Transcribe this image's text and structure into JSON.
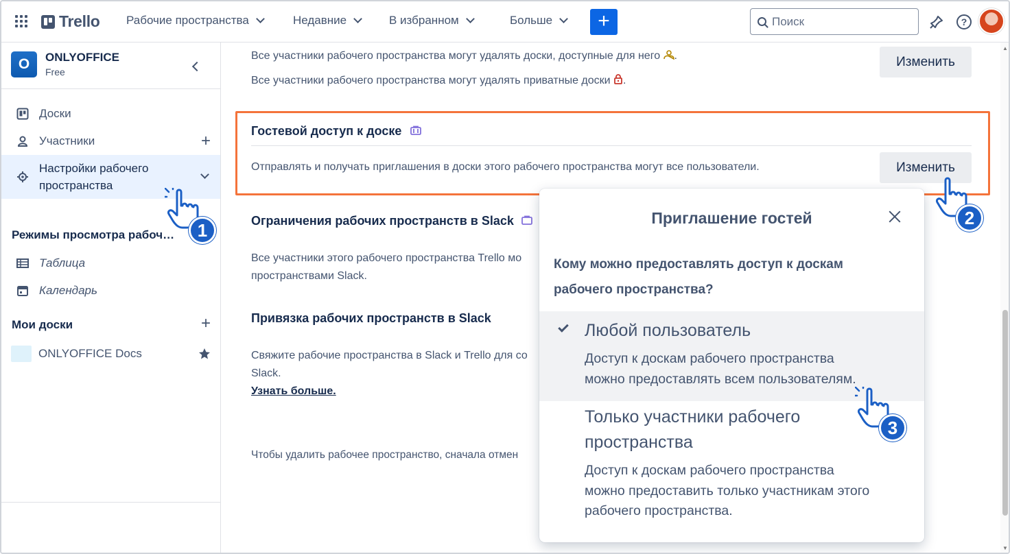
{
  "topbar": {
    "logo_text": "Trello",
    "nav": [
      "Рабочие пространства",
      "Недавние",
      "В избранном",
      "Больше"
    ],
    "create_label": "+",
    "search_placeholder": "Поиск"
  },
  "sidebar": {
    "workspace_initial": "O",
    "workspace_name": "ONLYOFFICE",
    "workspace_plan": "Free",
    "items": [
      {
        "label": "Доски",
        "icon": "board-icon"
      },
      {
        "label": "Участники",
        "icon": "person-icon"
      },
      {
        "label_line1": "Настройки рабочего",
        "label_line2": "пространства",
        "icon": "gear-icon"
      }
    ],
    "views_title": "Режимы просмотра рабоч…",
    "views": [
      {
        "label": "Таблица",
        "icon": "table-icon"
      },
      {
        "label": "Календарь",
        "icon": "calendar-icon"
      }
    ],
    "my_boards_title": "Мои доски",
    "boards": [
      {
        "label": "ONLYOFFICE Docs"
      }
    ]
  },
  "main": {
    "delete_line1": "Все участники рабочего пространства могут удалять доски, доступные для него",
    "delete_line2": "Все участники рабочего пространства могут удалять приватные доски",
    "change_label": "Изменить",
    "guest_title": "Гостевой доступ к доске",
    "guest_text": "Отправлять и получать приглашения в доски этого рабочего пространства могут все пользователи.",
    "slack_limits_title": "Ограничения рабочих пространств в Slack",
    "slack_limits_line1": "Все участники этого рабочего пространства Trello мо",
    "slack_limits_line2": "пространствами Slack.",
    "slack_link_title": "Привязка рабочих пространств в Slack",
    "slack_link_line1": "Свяжите рабочие пространства в Slack и Trello для со",
    "slack_link_line2": "Slack.",
    "learn_more": "Узнать больше.",
    "delete_ws_text": "Чтобы удалить рабочее пространство, сначала отмен"
  },
  "popover": {
    "title": "Приглашение гостей",
    "question_line1": "Кому можно предоставлять доступ к доскам",
    "question_line2": "рабочего пространства?",
    "options": [
      {
        "title": "Любой пользователь",
        "desc_line1": "Доступ к доскам рабочего пространства",
        "desc_line2": "можно предоставлять всем пользователям.",
        "selected": true
      },
      {
        "title_line1": "Только участники рабочего",
        "title_line2": "пространства",
        "desc_line1": "Доступ к доскам рабочего пространства",
        "desc_line2": "можно предоставить только участникам этого",
        "desc_line3": "рабочего пространства.",
        "selected": false
      }
    ]
  },
  "callouts": [
    "1",
    "2",
    "3"
  ],
  "colors": {
    "accent": "#0c66e4",
    "highlight_border": "#f4733a",
    "badge": "#1b5fc5",
    "selected_bg": "#e9f2ff"
  }
}
